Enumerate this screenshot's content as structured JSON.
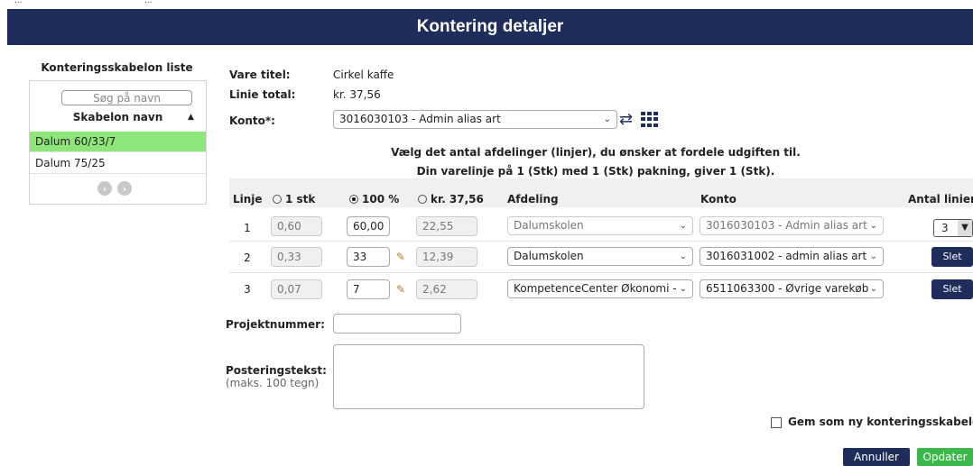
{
  "header": {
    "title": "Kontering detaljer"
  },
  "top_strip": {
    "left": "...",
    "right": "..."
  },
  "template_list": {
    "title": "Konteringsskabelon liste",
    "search_placeholder": "Søg på navn",
    "column": "Skabelon navn",
    "items": [
      "Dalum 60/33/7",
      "Dalum 75/25"
    ],
    "active_index": 0
  },
  "details": {
    "vare_label": "Vare titel:",
    "vare_value": "Cirkel kaffe",
    "total_label": "Linie total:",
    "total_value": "kr. 37,56",
    "konto_label": "Konto*:",
    "konto_value": "3016030103 - Admin alias art"
  },
  "info": {
    "line1": "Vælg det antal afdelinger (linjer), du ønsker at fordele udgiften til.",
    "line2": "Din varelinje på 1 (Stk) med 1 (Stk) pakning, giver 1 (Stk)."
  },
  "table": {
    "headers": {
      "linje": "Linje",
      "stk": "1 stk",
      "pct": "100 %",
      "kr": "kr. 37,56",
      "afdeling": "Afdeling",
      "konto": "Konto",
      "antal": "Antal linier"
    },
    "selected_mode": "pct",
    "rows": [
      {
        "num": "1",
        "stk": "0,60",
        "pct": "60,00",
        "kr": "22,55",
        "afdeling": "Dalumskolen",
        "konto": "3016030103 - Admin alias art"
      },
      {
        "num": "2",
        "stk": "0,33",
        "pct": "33",
        "kr": "12,39",
        "afdeling": "Dalumskolen",
        "konto": "3016031002 - admin alias art"
      },
      {
        "num": "3",
        "stk": "0,07",
        "pct": "7",
        "kr": "2,62",
        "afdeling": "KompetenceCenter Økonomi -",
        "konto": "6511063300 - Øvrige varekøb"
      }
    ],
    "antal_value": "3",
    "delete_label": "Slet"
  },
  "form": {
    "projekt_label": "Projektnummer:",
    "projekt_value": "",
    "post_label": "Posteringstekst:",
    "post_sub": "(maks. 100 tegn)",
    "post_value": ""
  },
  "footer": {
    "save_template_label": "Gem som ny konteringsskabelon",
    "cancel": "Annuller",
    "update": "Opdater"
  },
  "colors": {
    "header": "#1e2d59",
    "active_row": "#8ee57a",
    "update_btn": "#3bb84a"
  }
}
